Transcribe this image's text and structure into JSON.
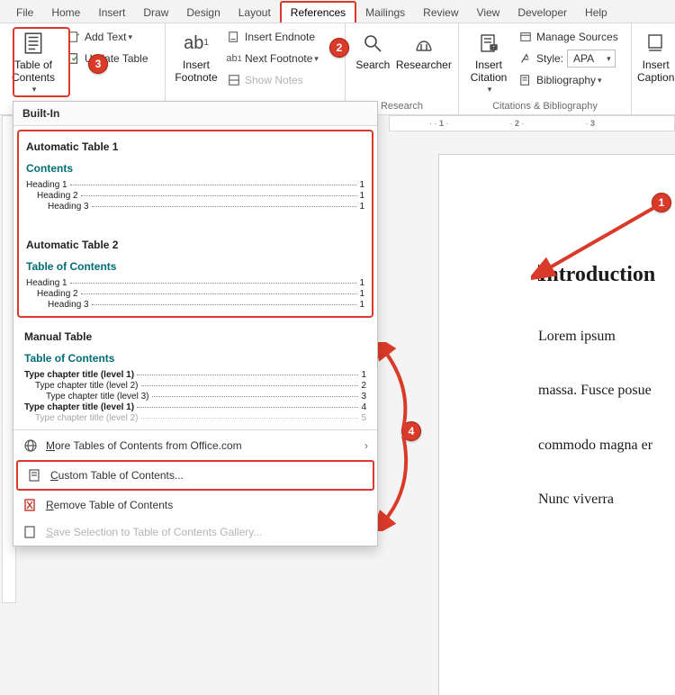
{
  "tabs": {
    "file": "File",
    "home": "Home",
    "insert": "Insert",
    "draw": "Draw",
    "design": "Design",
    "layout": "Layout",
    "references": "References",
    "mailings": "Mailings",
    "review": "Review",
    "view": "View",
    "developer": "Developer",
    "help": "Help"
  },
  "ribbon": {
    "toc": {
      "button": "Table of\nContents",
      "add_text": "Add Text",
      "update": "Update Table"
    },
    "footnotes": {
      "insert_footnote": "Insert\nFootnote",
      "insert_endnote": "Insert Endnote",
      "next_footnote": "Next Footnote",
      "show_notes": "Show Notes"
    },
    "research": {
      "search": "Search",
      "researcher": "Researcher",
      "group": "Research"
    },
    "citations": {
      "insert_citation": "Insert\nCitation",
      "manage_sources": "Manage Sources",
      "style_label": "Style:",
      "style_value": "APA",
      "bibliography": "Bibliography",
      "group": "Citations & Bibliography"
    },
    "captions": {
      "insert_caption": "Insert\nCaption"
    }
  },
  "toc_panel": {
    "built_in": "Built-In",
    "auto1": {
      "title": "Automatic Table 1",
      "heading": "Contents",
      "lines": [
        [
          "Heading 1",
          "1"
        ],
        [
          "Heading 2",
          "1"
        ],
        [
          "Heading 3",
          "1"
        ]
      ]
    },
    "auto2": {
      "title": "Automatic Table 2",
      "heading": "Table of Contents",
      "lines": [
        [
          "Heading 1",
          "1"
        ],
        [
          "Heading 2",
          "1"
        ],
        [
          "Heading 3",
          "1"
        ]
      ]
    },
    "manual": {
      "title": "Manual Table",
      "heading": "Table of Contents",
      "lines": [
        [
          "Type chapter title (level 1)",
          "1"
        ],
        [
          "Type chapter title (level 2)",
          "2"
        ],
        [
          "Type chapter title (level 3)",
          "3"
        ],
        [
          "Type chapter title (level 1)",
          "4"
        ],
        [
          "Type chapter title (level 2)",
          "5"
        ]
      ]
    },
    "more": "More Tables of Contents from Office.com",
    "custom": "Custom Table of Contents...",
    "remove": "Remove Table of Contents",
    "save": "Save Selection to Table of Contents Gallery..."
  },
  "ruler": {
    "m1": "1",
    "m2": "2",
    "m3": "3"
  },
  "doc": {
    "h1": "Introduction",
    "p1": "Lorem ipsum",
    "p2": "massa. Fusce posue",
    "p3": "commodo magna er",
    "p4": "Nunc viverra"
  },
  "badges": {
    "b1": "1",
    "b2": "2",
    "b3": "3",
    "b4": "4"
  }
}
